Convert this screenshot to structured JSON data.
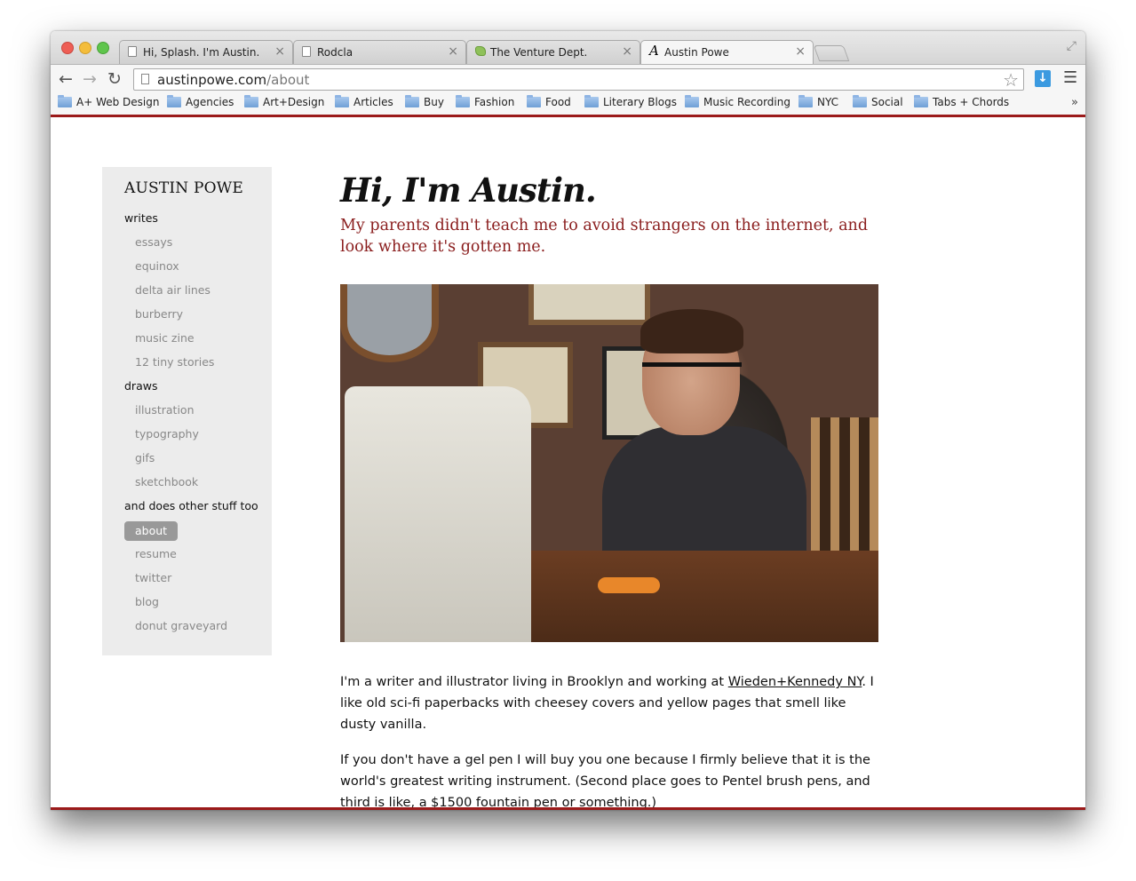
{
  "browser": {
    "tabs": [
      {
        "label": "Hi, Splash. I'm Austin.",
        "icon": "page-icon",
        "active": false
      },
      {
        "label": "Rodcla",
        "icon": "page-icon",
        "active": false
      },
      {
        "label": "The Venture Dept.",
        "icon": "leaf-icon",
        "active": false
      },
      {
        "label": "Austin Powe",
        "icon": "austin-logo-icon",
        "active": true
      }
    ],
    "tab_close": "×",
    "url_host": "austinpowe.com",
    "url_path": "/about",
    "bookmarks": [
      "A+ Web Design",
      "Agencies",
      "Art+Design",
      "Articles",
      "Buy",
      "Fashion",
      "Food",
      "Literary Blogs",
      "Music Recording",
      "NYC",
      "Social",
      "Tabs + Chords"
    ],
    "bookmarks_more": "»",
    "accent_color": "#9b1a1a"
  },
  "site": {
    "title": "AUSTIN POWE",
    "nav": [
      {
        "label": "writes",
        "type": "section"
      },
      {
        "label": "essays",
        "type": "sub"
      },
      {
        "label": "equinox",
        "type": "sub"
      },
      {
        "label": "delta air lines",
        "type": "sub"
      },
      {
        "label": "burberry",
        "type": "sub"
      },
      {
        "label": "music zine",
        "type": "sub"
      },
      {
        "label": "12 tiny stories",
        "type": "sub"
      },
      {
        "label": "draws",
        "type": "section"
      },
      {
        "label": "illustration",
        "type": "sub"
      },
      {
        "label": "typography",
        "type": "sub"
      },
      {
        "label": "gifs",
        "type": "sub"
      },
      {
        "label": "sketchbook",
        "type": "sub"
      },
      {
        "label": "and does other stuff too",
        "type": "section"
      },
      {
        "label": "about",
        "type": "sub",
        "active": true
      },
      {
        "label": "resume",
        "type": "sub"
      },
      {
        "label": "twitter",
        "type": "sub"
      },
      {
        "label": "blog",
        "type": "sub"
      },
      {
        "label": "donut graveyard",
        "type": "sub"
      }
    ]
  },
  "main": {
    "heading": "Hi, I'm Austin.",
    "subtitle": "My parents didn't teach me to avoid strangers on the internet, and look where it's gotten me.",
    "p1_before": "I'm a writer and illustrator living in Brooklyn and working at ",
    "p1_link": "Wieden+Kennedy NY",
    "p1_after": ". I like old sci-fi paperbacks with cheesey covers and yellow pages that smell like dusty vanilla.",
    "p2": "If you don't have a gel pen I will buy you one because I firmly believe that it is the world's greatest writing instrument. (Second place goes to Pentel brush pens, and third is like, a $1500 fountain pen or something.)"
  }
}
